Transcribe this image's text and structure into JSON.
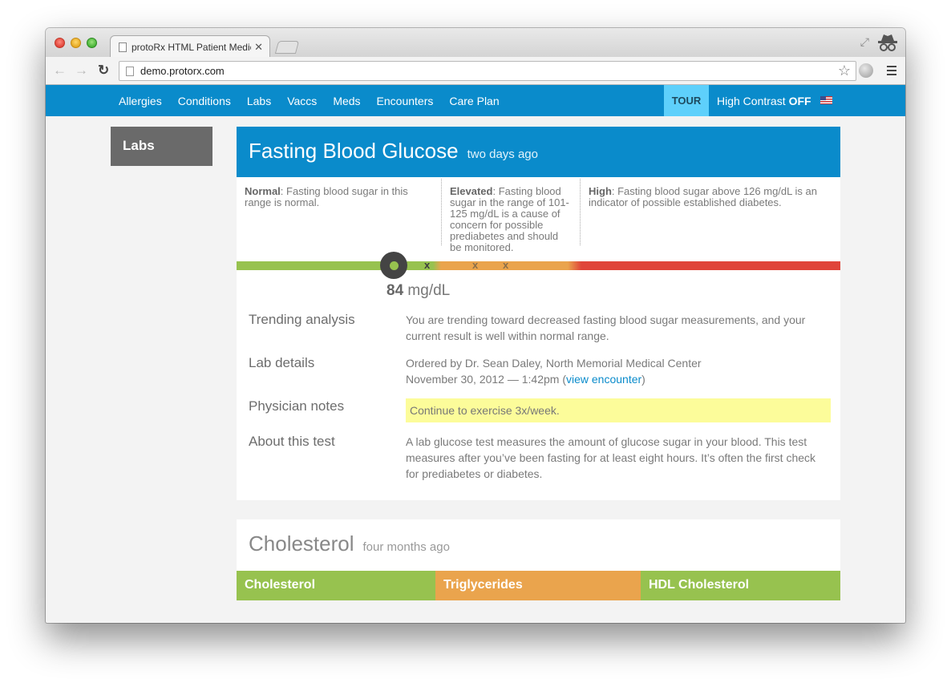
{
  "browser": {
    "tab_title": "protoRx HTML Patient Medic",
    "tab_close": "✕",
    "url": "demo.protorx.com"
  },
  "appnav": {
    "links": [
      "Allergies",
      "Conditions",
      "Labs",
      "Vaccs",
      "Meds",
      "Encounters",
      "Care Plan"
    ],
    "tour": "TOUR",
    "contrast_label": "High Contrast",
    "contrast_state": "OFF"
  },
  "sidebar": {
    "title": "Labs"
  },
  "glucose": {
    "title": "Fasting Blood Glucose",
    "when": "two days ago",
    "ranges": {
      "normal_label": "Normal",
      "normal_text": ": Fasting blood sugar in this range is normal.",
      "elevated_label": "Elevated",
      "elevated_text": ": Fasting blood sugar in the range of 101-125 mg/dL is a cause of concern for possible prediabetes and should be monitored.",
      "high_label": "High",
      "high_text": ": Fasting blood sugar above 126 mg/dL is an indicator of possible established diabetes."
    },
    "gauge": {
      "x_mark": "x",
      "value": "84",
      "unit": "mg/dL"
    },
    "trending_label": "Trending analysis",
    "trending_text": "You are trending toward decreased fasting blood sugar measurements, and your current result is well within normal range.",
    "details_label": "Lab details",
    "details_line1": "Ordered by Dr. Sean Daley, North Memorial Medical Center",
    "details_date": "November 30, 2012 — 1:42pm (",
    "details_link": "view encounter",
    "details_close": ")",
    "notes_label": "Physician notes",
    "notes_text": "Continue to exercise 3x/week.",
    "about_label": "About this test",
    "about_text": "A lab glucose test measures the amount of glucose sugar in your blood. This test measures after you’ve been fasting for at least eight hours. It’s often the first check for prediabetes or diabetes."
  },
  "cholesterol": {
    "title": "Cholesterol",
    "when": "four months ago",
    "tabs": [
      "Cholesterol",
      "Triglycerides",
      "HDL Cholesterol"
    ]
  },
  "colors": {
    "nav_blue": "#0a8bcb",
    "tour_blue": "#5ed0fb",
    "normal_green": "#97c24f",
    "elevated_orange": "#eaa44d",
    "high_red": "#e0453a",
    "note_yellow": "#fcfc9a"
  }
}
